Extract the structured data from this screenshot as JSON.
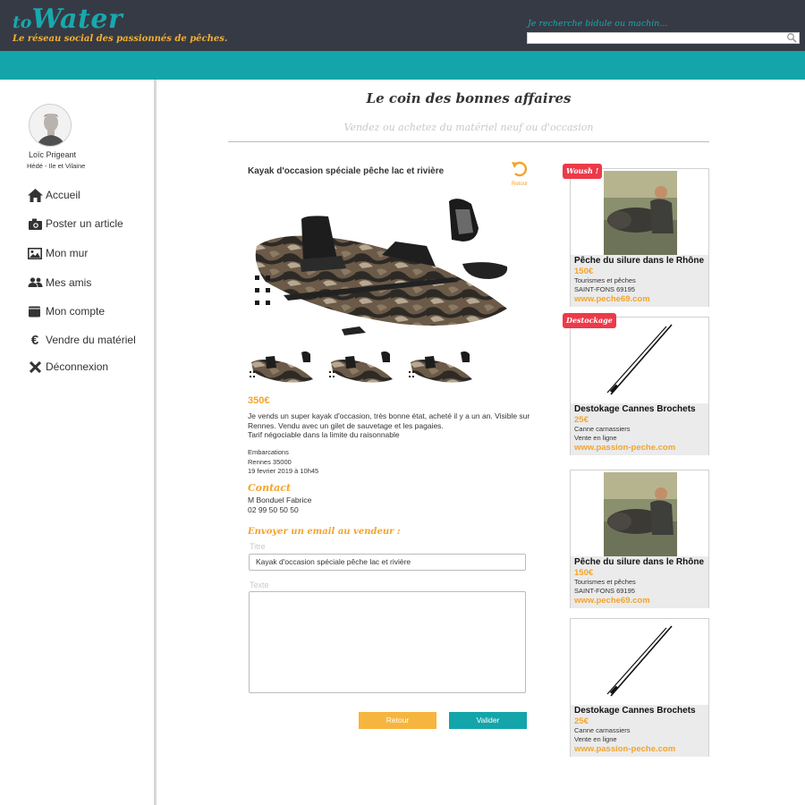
{
  "header": {
    "logo_to": "to",
    "logo_water": "Water",
    "tagline": "Le réseau social des passionnés de pêches.",
    "search_label": "Je recherche bidule ou machin...",
    "search_placeholder": ""
  },
  "user": {
    "name": "Loïc Prigeant",
    "location": "Hédé - Ile et Vilaine"
  },
  "sidebar": {
    "items": [
      {
        "label": "Accueil",
        "icon": "home-icon"
      },
      {
        "label": "Poster un article",
        "icon": "camera-icon"
      },
      {
        "label": "Mon mur",
        "icon": "image-icon"
      },
      {
        "label": "Mes amis",
        "icon": "users-icon"
      },
      {
        "label": "Mon compte",
        "icon": "wallet-icon"
      },
      {
        "label": "Vendre du matériel",
        "icon": "euro-icon"
      },
      {
        "label": "Déconnexion",
        "icon": "close-icon"
      }
    ]
  },
  "page": {
    "title": "Le coin des bonnes affaires",
    "subtitle": "Vendez ou achetez du matériel neuf ou d'occasion"
  },
  "article": {
    "title": "Kayak d'occasion spéciale pêche lac et rivière",
    "back_label": "Retour",
    "price": "350€",
    "description_lines": [
      "Je vends un super kayak d'occasion, très bonne état, acheté il y a un an. Visible sur",
      "Rennes. Vendu avec un gilet de sauvetage et les pagaies.",
      "Tarif négociable dans la limite du raisonnable"
    ],
    "category": "Embarcations",
    "location": "Rennes 35000",
    "date": "19 fevrier 2019 à 10h45"
  },
  "contact": {
    "title": "Contact",
    "name": "M Bonduel Fabrice",
    "phone": "02 99 50 50 50"
  },
  "email_form": {
    "title": "Envoyer un email au vendeur :",
    "titre_label": "Titre",
    "titre_value": "Kayak d'occasion spéciale pêche lac et rivière",
    "texte_label": "Texte",
    "texte_value": "",
    "retour_label": "Retour",
    "valider_label": "Valider"
  },
  "ads": [
    {
      "badge": "Woush !",
      "title": "Pêche du silure dans le Rhône",
      "price": "150€",
      "line1": "Tourismes et pêches",
      "line2": "SAINT-FONS 69195",
      "url": "www.peche69.com",
      "image": "fish-photo"
    },
    {
      "badge": "Destockage",
      "title": "Destokage Cannes Brochets",
      "price": "25€",
      "line1": "Canne carnassiers",
      "line2": "Vente en ligne",
      "url": "www.passion-peche.com",
      "image": "rod-photo"
    },
    {
      "badge": "",
      "title": "Pêche du silure dans le Rhône",
      "price": "150€",
      "line1": "Tourismes et pêches",
      "line2": "SAINT-FONS 69195",
      "url": "www.peche69.com",
      "image": "fish-photo"
    },
    {
      "badge": "",
      "title": "Destokage Cannes Brochets",
      "price": "25€",
      "line1": "Canne carnassiers",
      "line2": "Vente en ligne",
      "url": "www.passion-peche.com",
      "image": "rod-photo"
    }
  ],
  "colors": {
    "header_bg": "#363a45",
    "teal": "#13a5aa",
    "orange": "#f3a42b",
    "badge_red": "#ec3a4a"
  }
}
